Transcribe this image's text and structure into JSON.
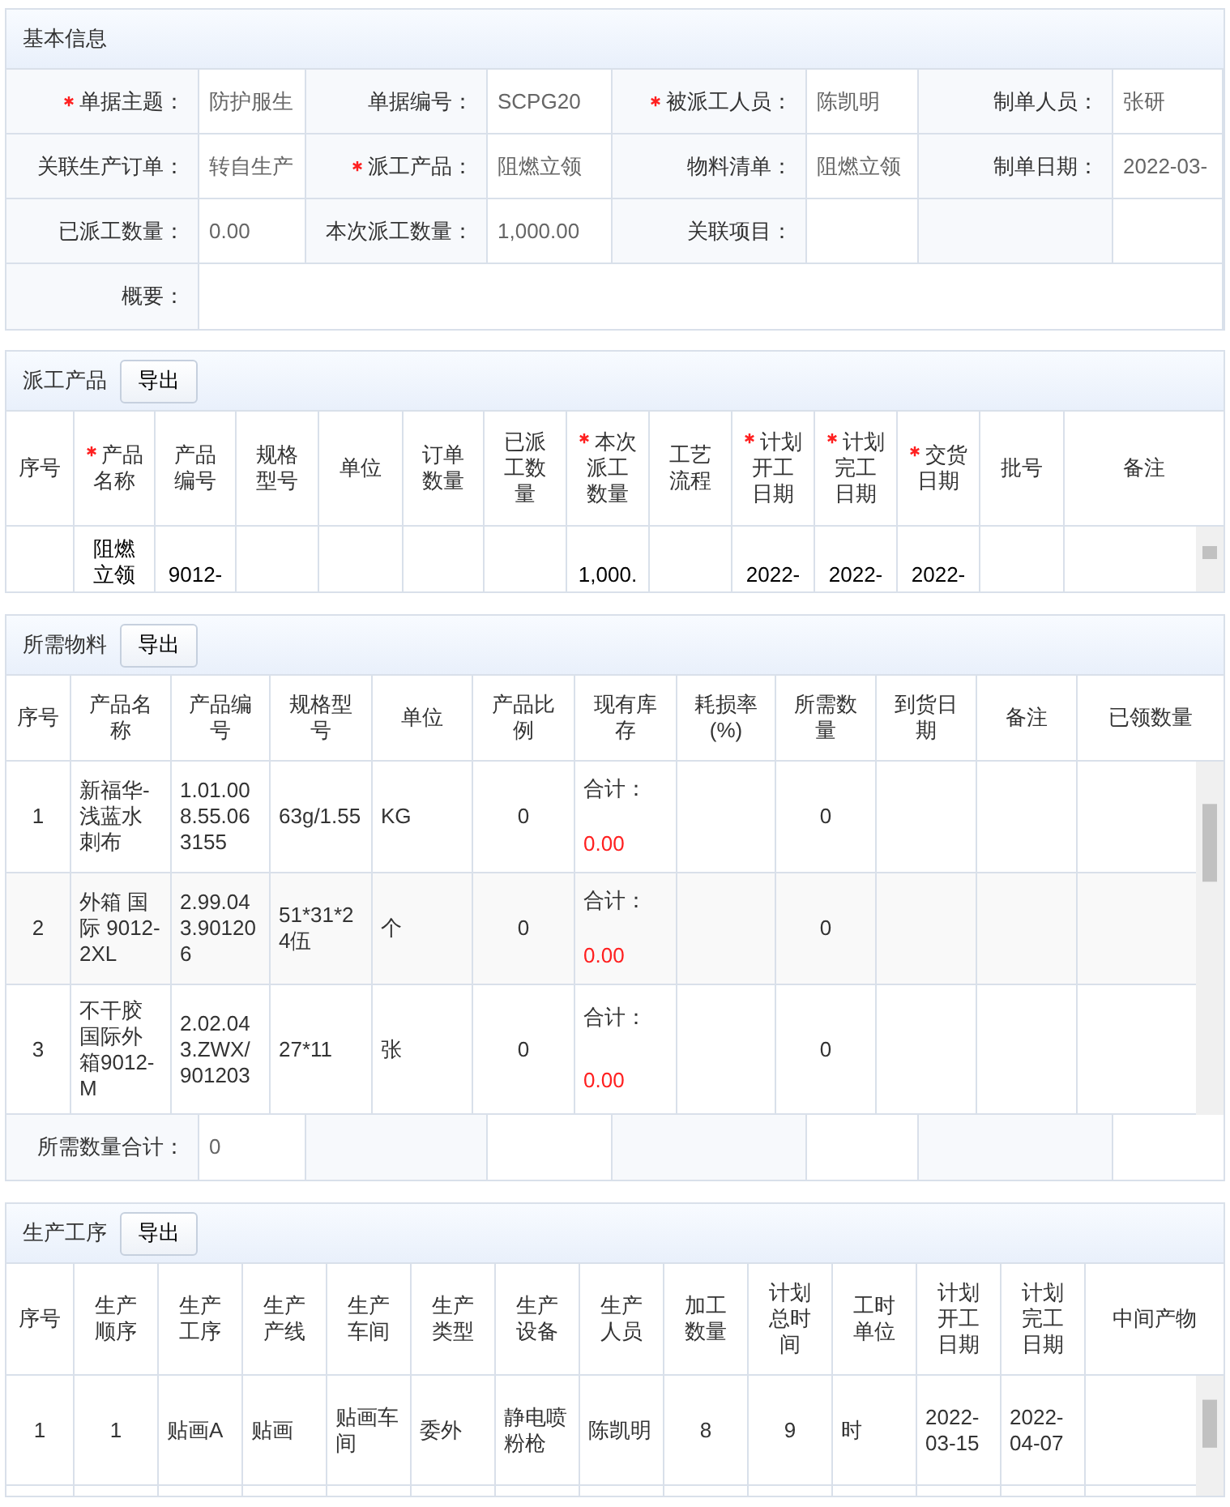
{
  "basic_info": {
    "title": "基本信息",
    "rows": [
      [
        {
          "label": "单据主题：",
          "required": true,
          "value": "防护服生"
        },
        {
          "label": "单据编号：",
          "required": false,
          "value": "SCPG20"
        },
        {
          "label": "被派工人员：",
          "required": true,
          "value": "陈凯明"
        },
        {
          "label": "制单人员：",
          "required": false,
          "value": "张研"
        }
      ],
      [
        {
          "label": "关联生产订单：",
          "required": false,
          "value": "转自生产"
        },
        {
          "label": "派工产品：",
          "required": true,
          "value": "阻燃立领"
        },
        {
          "label": "物料清单：",
          "required": false,
          "value": "阻燃立领"
        },
        {
          "label": "制单日期：",
          "required": false,
          "value": "2022-03-"
        }
      ],
      [
        {
          "label": "已派工数量：",
          "required": false,
          "value": "0.00"
        },
        {
          "label": "本次派工数量：",
          "required": false,
          "value": "1,000.00"
        },
        {
          "label": "关联项目：",
          "required": false
        }
      ]
    ],
    "summary": {
      "label": "概要："
    }
  },
  "products": {
    "title": "派工产品",
    "export_button": "导出",
    "columns": [
      {
        "label": "序号",
        "required": false
      },
      {
        "label": "产品名称",
        "required": true
      },
      {
        "label": "产品编号",
        "required": false
      },
      {
        "label": "规格型号",
        "required": false
      },
      {
        "label": "单位",
        "required": false
      },
      {
        "label": "订单数量",
        "required": false
      },
      {
        "label": "已派工数量",
        "required": false
      },
      {
        "label": "本次派工数量",
        "required": true
      },
      {
        "label": "工艺流程",
        "required": false
      },
      {
        "label": "计划开工日期",
        "required": true
      },
      {
        "label": "计划完工日期",
        "required": true
      },
      {
        "label": "交货日期",
        "required": true
      },
      {
        "label": "批号",
        "required": false
      },
      {
        "label": "备注",
        "required": false
      }
    ],
    "rows": [
      {
        "product_name": "阻燃立领",
        "product_code": "9012-",
        "this_qty": "1,000.",
        "start_date": "2022-",
        "finish_date": "2022-",
        "delivery_date": "2022-"
      }
    ]
  },
  "materials": {
    "title": "所需物料",
    "export_button": "导出",
    "columns": [
      "序号",
      "产品名称",
      "产品编号",
      "规格型号",
      "单位",
      "产品比例",
      "现有库存",
      "耗损率(%)",
      "所需数量",
      "到货日期",
      "备注",
      "已领数量"
    ],
    "rows": [
      {
        "index": "1",
        "name": "新福华-浅蓝水刺布",
        "code": "1.01.008.55.063155",
        "spec": "63g/1.55",
        "unit": "KG",
        "ratio": "0",
        "stock_label": "合计：",
        "stock_value": "0.00",
        "required_qty": "0"
      },
      {
        "index": "2",
        "name": "外箱 国际 9012-2XL",
        "code": "2.99.043.901206",
        "spec": "51*31*24伍",
        "unit": "个",
        "ratio": "0",
        "stock_label": "合计：",
        "stock_value": "0.00",
        "required_qty": "0"
      },
      {
        "index": "3",
        "name": "不干胶国际外箱9012-M",
        "code": "2.02.043.ZWX/901203",
        "spec": "27*11",
        "unit": "张",
        "ratio": "0",
        "stock_label": "合计：",
        "stock_value": "0.00",
        "required_qty": "0"
      }
    ],
    "total": {
      "label": "所需数量合计：",
      "value": "0"
    }
  },
  "processes": {
    "title": "生产工序",
    "export_button": "导出",
    "columns": [
      "序号",
      "生产顺序",
      "生产工序",
      "生产产线",
      "生产车间",
      "生产类型",
      "生产设备",
      "生产人员",
      "加工数量",
      "计划总时间",
      "工时单位",
      "计划开工日期",
      "计划完工日期",
      "中间产物"
    ],
    "rows": [
      {
        "index": "1",
        "order": "1",
        "process": "贴画A",
        "line": "贴画",
        "workshop": "贴画车间",
        "type": "委外",
        "equipment": "静电喷粉枪",
        "worker": "陈凯明",
        "qty": "8",
        "hours": "9",
        "unit": "时",
        "start": "2022-03-15",
        "finish": "2022-04-07"
      }
    ]
  }
}
